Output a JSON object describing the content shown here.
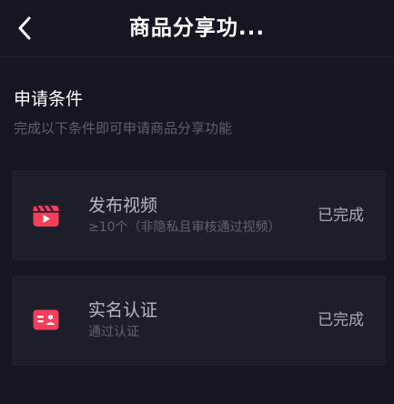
{
  "header": {
    "back_icon": "chevron-left-icon",
    "title": "商品分享功..."
  },
  "section": {
    "title": "申请条件",
    "subtitle": "完成以下条件即可申请商品分享功能"
  },
  "conditions": [
    {
      "icon": "video-clapper-icon",
      "title": "发布视频",
      "description": "≥10个（非隐私且审核通过视频）",
      "status": "已完成"
    },
    {
      "icon": "id-card-icon",
      "title": "实名认证",
      "description": "通过认证",
      "status": "已完成"
    }
  ],
  "colors": {
    "background": "#161622",
    "card": "#1e1e2a",
    "icon_accent": "#f33f5b"
  }
}
